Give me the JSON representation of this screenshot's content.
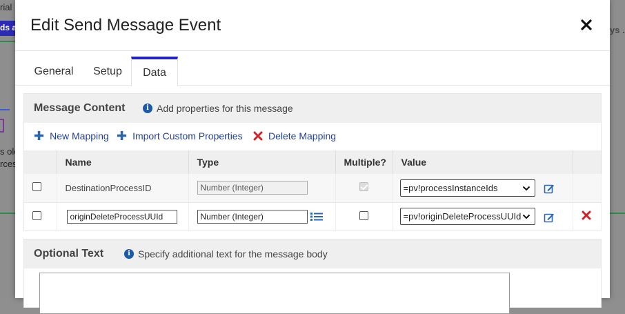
{
  "background": {
    "top_text": "rial",
    "badge_text": "ds a",
    "right_text": "ys .",
    "left_text_1": "s olc",
    "left_text_2": "rces"
  },
  "dialog": {
    "title": "Edit Send Message Event",
    "close_icon": "close-icon",
    "tabs": [
      {
        "label": "General",
        "active": false
      },
      {
        "label": "Setup",
        "active": false
      },
      {
        "label": "Data",
        "active": true
      }
    ]
  },
  "message_content": {
    "title": "Message Content",
    "info": "Add properties for this message",
    "toolbar": {
      "new_mapping": "New Mapping",
      "import_custom_properties": "Import Custom Properties",
      "delete_mapping": "Delete Mapping"
    },
    "columns": [
      "Name",
      "Type",
      "Multiple?",
      "Value"
    ],
    "rows": [
      {
        "selected": false,
        "name": "DestinationProcessID",
        "name_editable": false,
        "type": "Number (Integer)",
        "type_editable": false,
        "multiple": true,
        "multiple_disabled": true,
        "value": "=pv!processInstanceIds",
        "deletable": false
      },
      {
        "selected": false,
        "name": "originDeleteProcessUUId",
        "name_editable": true,
        "type": "Number (Integer)",
        "type_editable": true,
        "multiple": false,
        "multiple_disabled": false,
        "value": "=pv!originDeleteProcessUUId",
        "deletable": true
      }
    ]
  },
  "optional_text": {
    "title": "Optional Text",
    "info": "Specify additional text for the message body",
    "value": ""
  },
  "colors": {
    "accent": "#2222cc",
    "link": "#1f3fa0",
    "delete": "#d0202a",
    "info": "#1a5aa8"
  }
}
